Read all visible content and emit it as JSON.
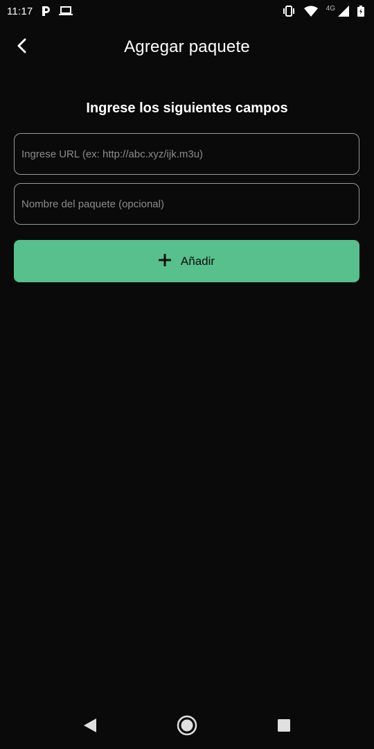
{
  "status_bar": {
    "time": "11:17",
    "network_label": "4G",
    "icons": [
      "parking-app-icon",
      "laptop-icon",
      "vibrate-icon",
      "wifi-icon",
      "signal-icon",
      "battery-icon"
    ]
  },
  "header": {
    "title": "Agregar paquete",
    "back_icon": "chevron-left-icon"
  },
  "form": {
    "heading": "Ingrese los siguientes campos",
    "url_field": {
      "value": "",
      "placeholder": "Ingrese URL (ex: http://abc.xyz/ijk.m3u)"
    },
    "name_field": {
      "value": "",
      "placeholder": "Nombre del paquete (opcional)"
    },
    "add_button": {
      "label": "Añadir",
      "icon": "plus-icon"
    }
  },
  "nav_bar": {
    "buttons": [
      "back-triangle-icon",
      "home-circle-icon",
      "recents-square-icon"
    ]
  },
  "colors": {
    "background": "#0a0a0a",
    "accent": "#57c08d",
    "field_border": "#9a9a9a",
    "placeholder": "#8c8c8c"
  }
}
